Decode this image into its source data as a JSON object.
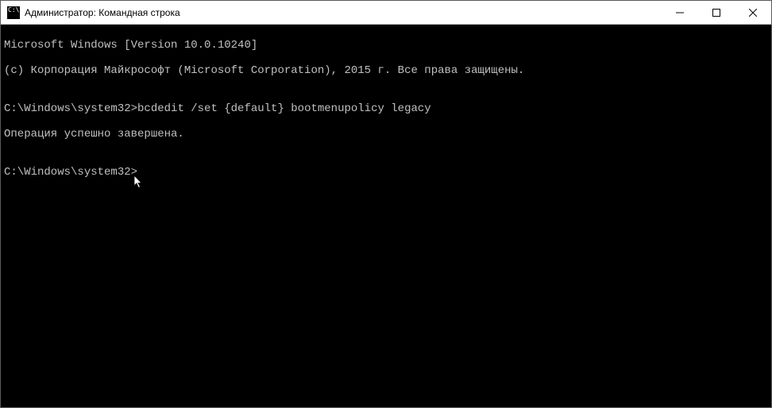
{
  "window": {
    "title": "Администратор: Командная строка"
  },
  "terminal": {
    "line1": "Microsoft Windows [Version 10.0.10240]",
    "line2": "(c) Корпорация Майкрософт (Microsoft Corporation), 2015 г. Все права защищены.",
    "blank1": "",
    "prompt1_path": "C:\\Windows\\system32>",
    "prompt1_cmd": "bcdedit /set {default} bootmenupolicy legacy",
    "result1": "Операция успешно завершена.",
    "blank2": "",
    "prompt2_path": "C:\\Windows\\system32>"
  }
}
